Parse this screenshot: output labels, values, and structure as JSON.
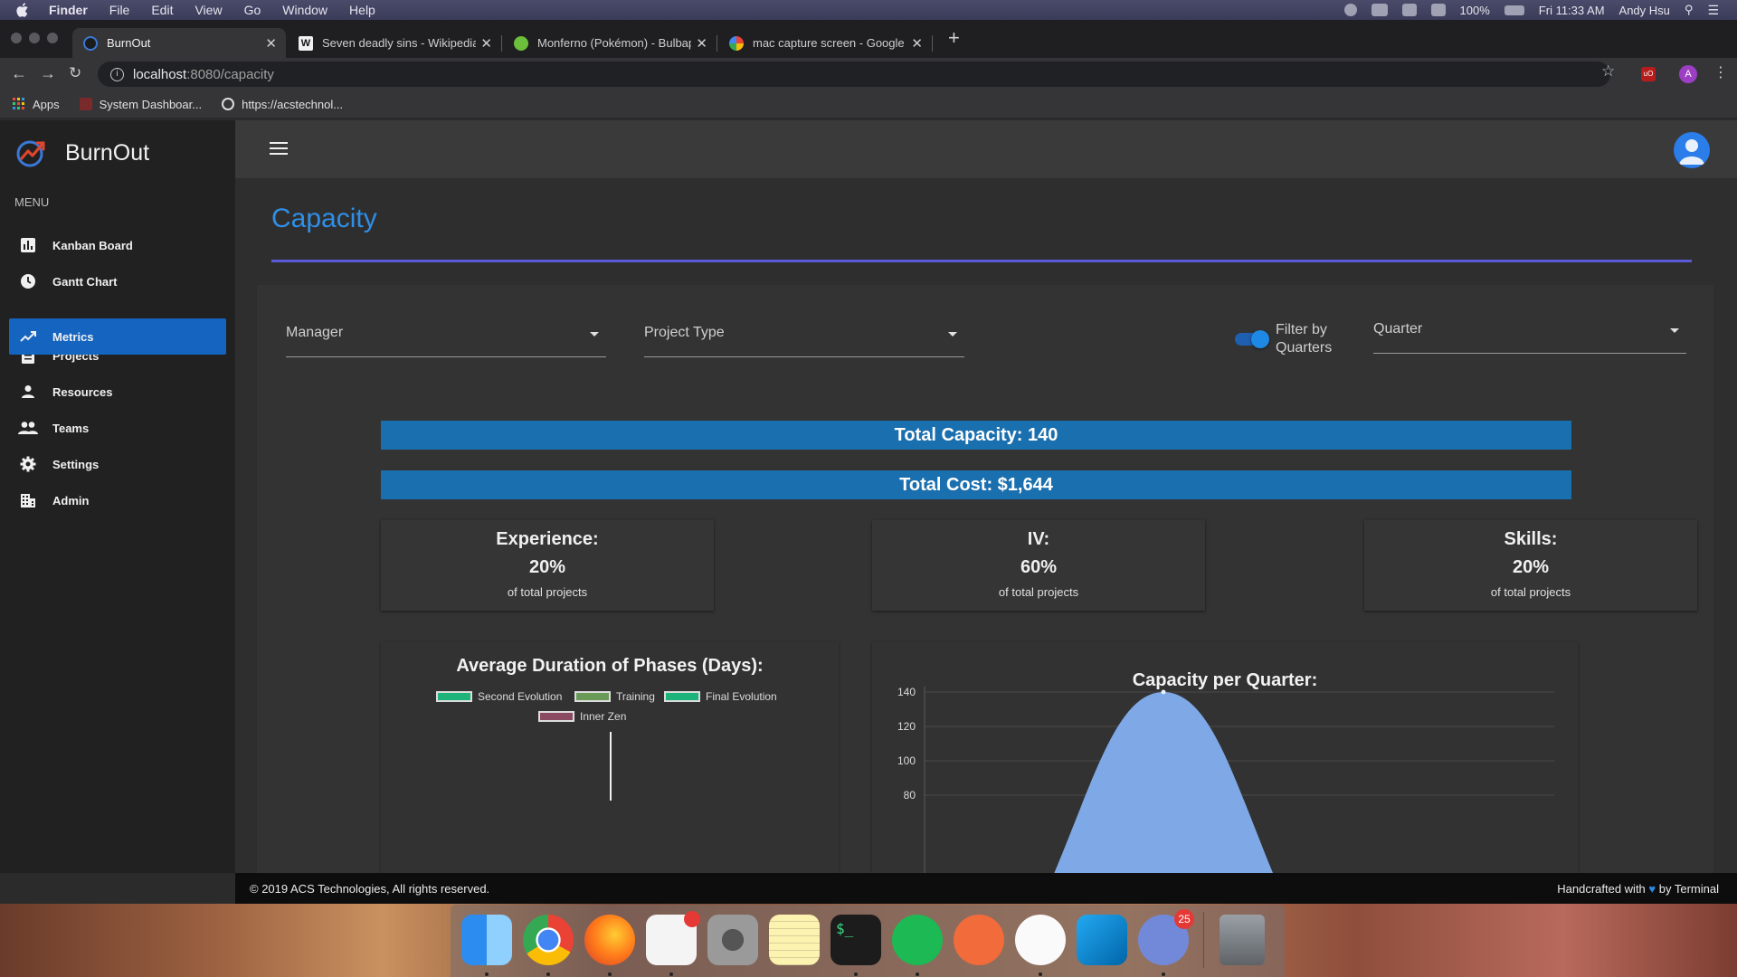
{
  "macos": {
    "menu": [
      "Finder",
      "File",
      "Edit",
      "View",
      "Go",
      "Window",
      "Help"
    ],
    "battery": "100%",
    "clock": "Fri 11:33 AM",
    "user": "Andy Hsu"
  },
  "browser": {
    "tabs": [
      {
        "title": "BurnOut",
        "active": true
      },
      {
        "title": "Seven deadly sins - Wikipedia",
        "active": false
      },
      {
        "title": "Monferno (Pokémon) - Bulbap",
        "active": false
      },
      {
        "title": "mac capture screen - Google S",
        "active": false
      }
    ],
    "url_host": "localhost",
    "url_path": ":8080/capacity",
    "profile_initial": "A",
    "bookmarks": [
      "Apps",
      "System Dashboar...",
      "https://acstechnol..."
    ]
  },
  "app": {
    "name": "BurnOut",
    "menu_label": "MENU",
    "nav": [
      {
        "label": "Kanban Board",
        "icon": "bar-chart-icon"
      },
      {
        "label": "Gantt Chart",
        "icon": "clock-icon"
      },
      {
        "label": "Metrics",
        "icon": "trending-up-icon",
        "active": true
      },
      {
        "label": "Projects",
        "icon": "clipboard-icon"
      },
      {
        "label": "Resources",
        "icon": "person-icon"
      },
      {
        "label": "Teams",
        "icon": "people-icon"
      },
      {
        "label": "Settings",
        "icon": "gear-icon"
      },
      {
        "label": "Admin",
        "icon": "building-icon"
      }
    ]
  },
  "page": {
    "title": "Capacity",
    "filters": {
      "manager": "Manager",
      "project_type": "Project Type",
      "toggle_label": "Filter by Quarters",
      "toggle_on": true,
      "quarter": "Quarter"
    },
    "total_capacity": "Total Capacity: 140",
    "total_cost": "Total Cost: $1,644",
    "stats": [
      {
        "title": "Experience:",
        "value": "20%",
        "sub": "of total projects"
      },
      {
        "title": "IV:",
        "value": "60%",
        "sub": "of total projects"
      },
      {
        "title": "Skills:",
        "value": "20%",
        "sub": "of total projects"
      }
    ]
  },
  "chart_data": [
    {
      "type": "bar",
      "title": "Average Duration of Phases (Days):",
      "series": [
        {
          "name": "Second Evolution",
          "color": "#1db37a"
        },
        {
          "name": "Training",
          "color": "#6a9a58"
        },
        {
          "name": "Final Evolution",
          "color": "#1db37a"
        },
        {
          "name": "Inner Zen",
          "color": "#8a4a62"
        }
      ]
    },
    {
      "type": "area",
      "title": "Capacity per Quarter:",
      "y_ticks": [
        140,
        120,
        100,
        80
      ],
      "fill_color": "#7ea8e6",
      "peak_value": 140
    }
  ],
  "footer": {
    "left": "© 2019 ACS Technologies, All rights reserved.",
    "right_prefix": "Handcrafted with",
    "right_suffix": "by Terminal"
  },
  "dock": {
    "apps": [
      "finder-icon",
      "chrome-icon",
      "firefox-icon",
      "slack-icon",
      "system-preferences-icon",
      "notes-icon",
      "terminal-icon",
      "spotify-icon",
      "postman-icon",
      "bear-icon",
      "vscode-icon",
      "discord-icon",
      "trash-icon"
    ],
    "slack_badge": "",
    "discord_badge": "25"
  }
}
